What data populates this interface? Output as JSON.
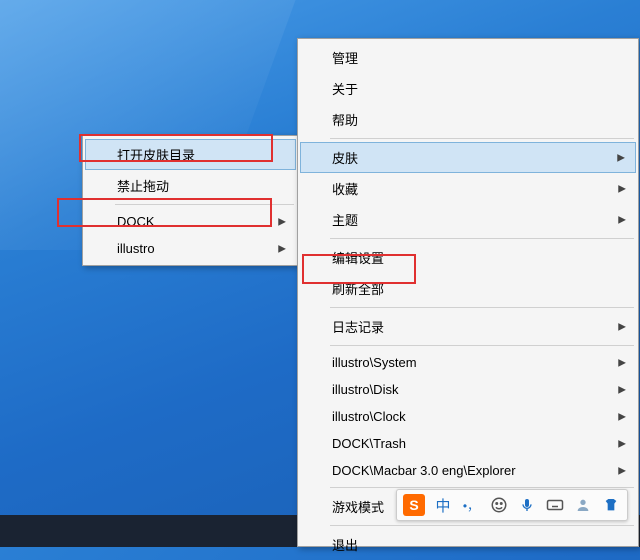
{
  "submenu": {
    "items": [
      {
        "label": "打开皮肤目录",
        "hasChevron": false,
        "highlighted": true
      },
      {
        "label": "禁止拖动",
        "hasChevron": false
      },
      {
        "label": "DOCK",
        "hasChevron": true
      },
      {
        "label": "illustro",
        "hasChevron": true
      }
    ]
  },
  "menu": {
    "groups": [
      [
        {
          "label": "管理",
          "hasChevron": false
        },
        {
          "label": "关于",
          "hasChevron": false
        },
        {
          "label": "帮助",
          "hasChevron": false
        }
      ],
      [
        {
          "label": "皮肤",
          "hasChevron": true,
          "highlighted": true
        },
        {
          "label": "收藏",
          "hasChevron": true
        },
        {
          "label": "主题",
          "hasChevron": true
        }
      ],
      [
        {
          "label": "编辑设置",
          "hasChevron": false
        },
        {
          "label": "刷新全部",
          "hasChevron": false
        }
      ],
      [
        {
          "label": "日志记录",
          "hasChevron": true
        }
      ],
      [
        {
          "label": "illustro\\System",
          "hasChevron": true
        },
        {
          "label": "illustro\\Disk",
          "hasChevron": true
        },
        {
          "label": "illustro\\Clock",
          "hasChevron": true
        },
        {
          "label": "DOCK\\Trash",
          "hasChevron": true
        },
        {
          "label": "DOCK\\Macbar 3.0 eng\\Explorer",
          "hasChevron": true
        }
      ],
      [
        {
          "label": "游戏模式",
          "hasChevron": false
        }
      ],
      [
        {
          "label": "退出",
          "hasChevron": false
        }
      ]
    ]
  },
  "ime": {
    "logo": "S",
    "lang": "中",
    "punct": "•，"
  }
}
